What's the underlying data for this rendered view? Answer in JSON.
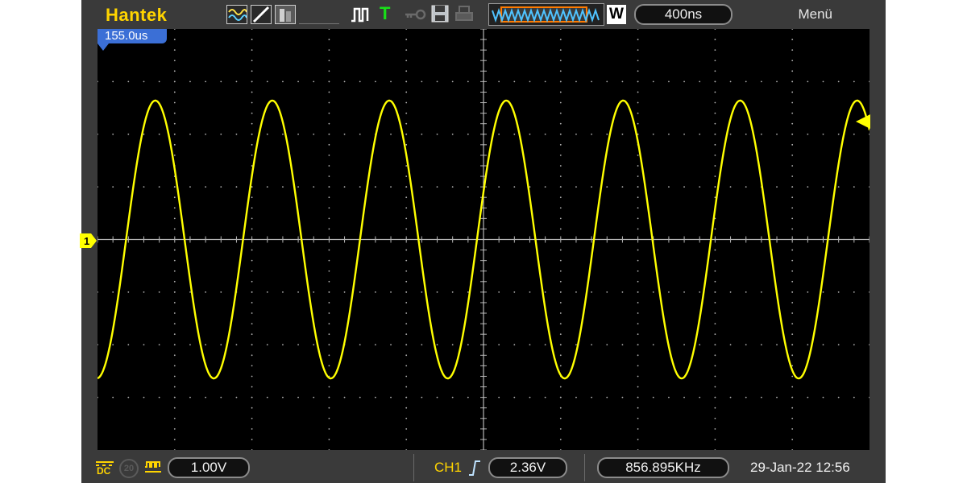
{
  "brand": "Hantek",
  "menu_label": "Menü",
  "timebase": "400ns",
  "window_label": "W",
  "trigger_position": "155.0us",
  "channel_marker": "1",
  "ch1_scale": "1.00V",
  "probe_label": "20",
  "coupling": "DC",
  "trigger_source": "CH1",
  "trigger_level": "2.36V",
  "frequency": "856.895KHz",
  "datetime": "29-Jan-22 12:56",
  "signal": {
    "cycles_on_screen": 6.6,
    "amplitude_divs": 2.0,
    "offset_divs": 0.0
  },
  "colors": {
    "trace": "#ffff00",
    "grid": "#b4b4b4",
    "screen_bg": "#000000",
    "frame_bg": "#3a3a3a",
    "brand": "#ffd400",
    "trigger_status": "#18e018",
    "marker_blue": "#3b6fd6"
  },
  "icons": [
    "waveform-mode-icon",
    "line-mode-icon",
    "persistence-icon",
    "trigger-edge-icon",
    "trigged-status-icon",
    "key-lock-icon",
    "save-icon",
    "print-icon",
    "memory-waveform-icon",
    "coupling-dc-icon",
    "bandwidth-limit-icon",
    "hf-reject-icon",
    "trigger-rising-edge-icon",
    "trigger-level-arrow-icon",
    "channel1-marker-icon"
  ]
}
